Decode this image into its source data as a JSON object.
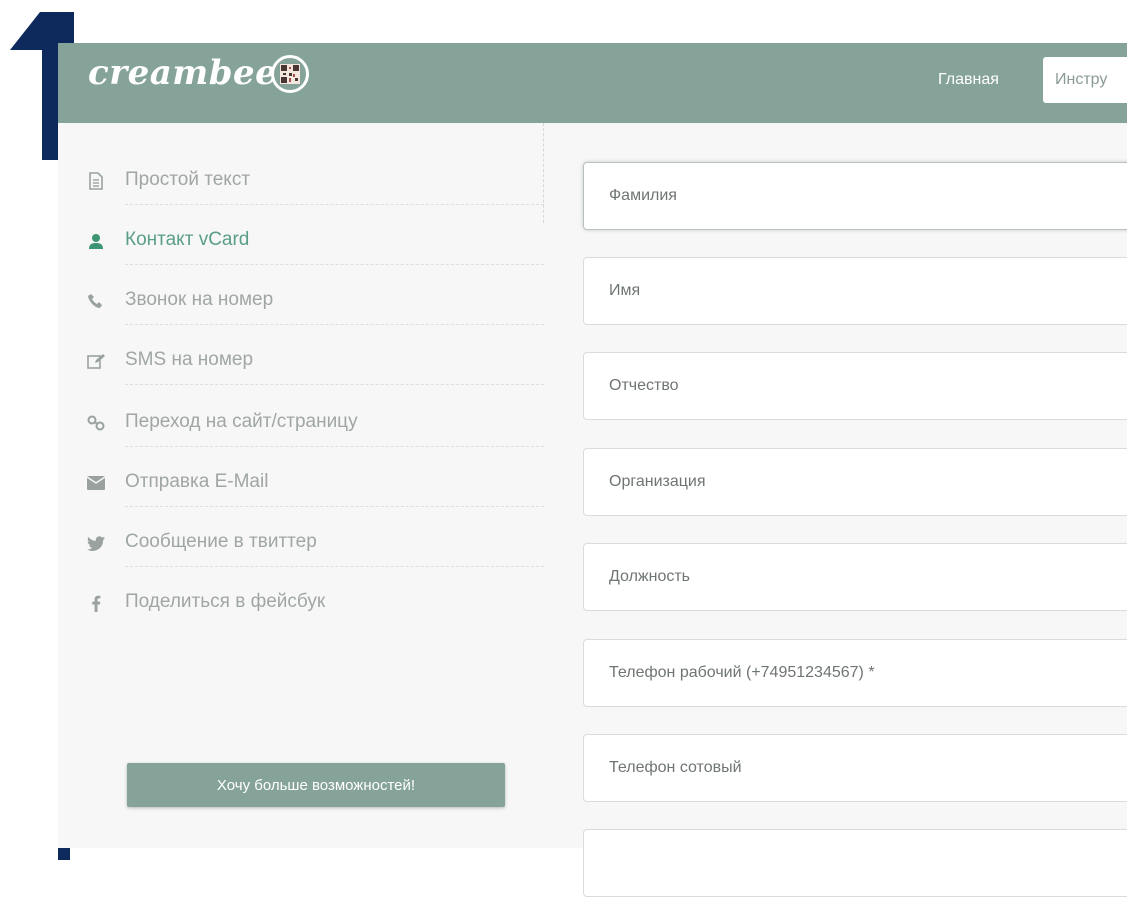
{
  "step": "1",
  "header": {
    "logo_text": "creambee",
    "nav_home": "Главная",
    "nav_tools": "Инстру"
  },
  "sidebar": {
    "items": [
      {
        "label": "Простой текст",
        "icon": "document-icon",
        "active": false
      },
      {
        "label": "Контакт vCard",
        "icon": "person-icon",
        "active": true
      },
      {
        "label": "Звонок на номер",
        "icon": "phone-icon",
        "active": false
      },
      {
        "label": "SMS на номер",
        "icon": "edit-icon",
        "active": false
      },
      {
        "label": "Переход на сайт/страницу",
        "icon": "link-icon",
        "active": false
      },
      {
        "label": "Отправка E-Mail",
        "icon": "envelope-icon",
        "active": false
      },
      {
        "label": "Сообщение в твиттер",
        "icon": "twitter-icon",
        "active": false
      },
      {
        "label": "Поделиться в фейсбук",
        "icon": "facebook-icon",
        "active": false
      }
    ],
    "more_button": "Хочу больше возможностей!"
  },
  "form": {
    "fields": [
      {
        "placeholder": "Фамилия"
      },
      {
        "placeholder": "Имя"
      },
      {
        "placeholder": "Отчество"
      },
      {
        "placeholder": "Организация"
      },
      {
        "placeholder": "Должность"
      },
      {
        "placeholder": "Телефон рабочий (+74951234567) *"
      },
      {
        "placeholder": "Телефон сотовый"
      },
      {
        "placeholder": ""
      }
    ]
  },
  "colors": {
    "brand": "#86a399",
    "active": "#3d9673",
    "step_number": "#0e2a5c"
  }
}
